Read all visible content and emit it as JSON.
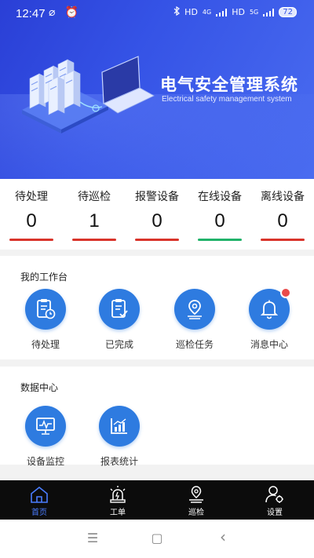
{
  "status_bar": {
    "time": "12:47",
    "left_icons": "⌀ ⏰",
    "network_labels": [
      "HD",
      "4G",
      "HD",
      "5G"
    ],
    "battery": "72"
  },
  "banner": {
    "title": "电气安全管理系统",
    "subtitle": "Electrical safety management system"
  },
  "stats": [
    {
      "label": "待处理",
      "value": "0",
      "bar_color": "#d9342b"
    },
    {
      "label": "待巡检",
      "value": "1",
      "bar_color": "#d9342b"
    },
    {
      "label": "报警设备",
      "value": "0",
      "bar_color": "#d9342b"
    },
    {
      "label": "在线设备",
      "value": "0",
      "bar_color": "#21b26a"
    },
    {
      "label": "离线设备",
      "value": "0",
      "bar_color": "#d9342b"
    }
  ],
  "workbench": {
    "title": "我的工作台",
    "tiles": [
      {
        "label": "待处理",
        "icon": "clipboard-clock-icon"
      },
      {
        "label": "已完成",
        "icon": "clipboard-check-icon"
      },
      {
        "label": "巡检任务",
        "icon": "location-pin-icon"
      },
      {
        "label": "消息中心",
        "icon": "bell-icon",
        "badge": true
      }
    ]
  },
  "data_center": {
    "title": "数据中心",
    "tiles": [
      {
        "label": "设备监控",
        "icon": "monitor-icon"
      },
      {
        "label": "报表统计",
        "icon": "chart-icon"
      }
    ]
  },
  "bottom_nav": [
    {
      "label": "首页",
      "icon": "home-icon",
      "active": true
    },
    {
      "label": "工单",
      "icon": "alarm-light-icon",
      "active": false
    },
    {
      "label": "巡检",
      "icon": "location-pin-icon",
      "active": false
    },
    {
      "label": "设置",
      "icon": "user-settings-icon",
      "active": false
    }
  ],
  "system_nav": {
    "menu": "☰",
    "home": "▢",
    "back": "‹"
  },
  "colors": {
    "accent": "#2e7be0",
    "banner": "#3553e6",
    "alert": "#d9342b",
    "online": "#21b26a",
    "nav_active": "#4a7dff"
  }
}
